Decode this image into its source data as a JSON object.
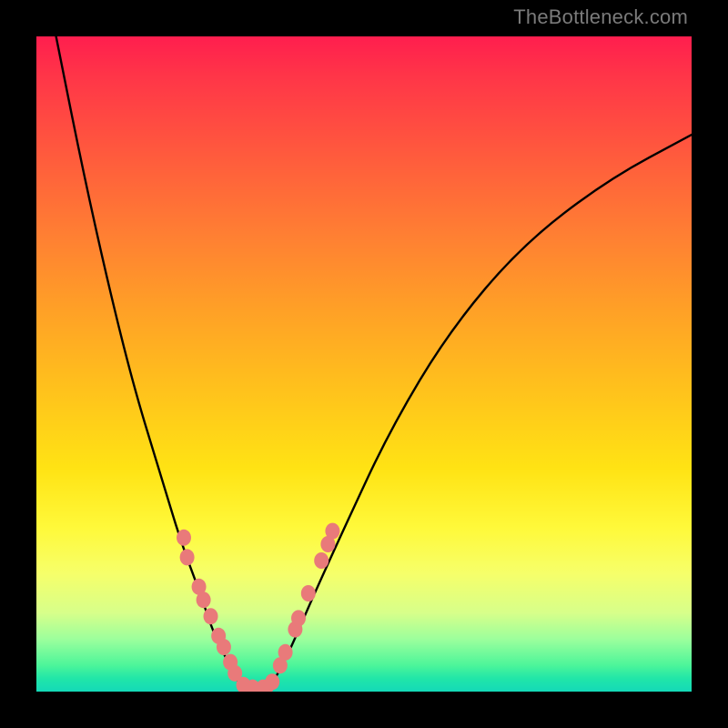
{
  "watermark": "TheBottleneck.com",
  "chart_data": {
    "type": "line",
    "title": "",
    "xlabel": "",
    "ylabel": "",
    "xlim": [
      0,
      1
    ],
    "ylim": [
      0,
      1
    ],
    "annotations": [
      "Background gradient: red (top, worst) → yellow (middle) → green (bottom, best)"
    ],
    "series": [
      {
        "name": "left-curve",
        "x": [
          0.03,
          0.07,
          0.11,
          0.15,
          0.19,
          0.22,
          0.25,
          0.27,
          0.29,
          0.305,
          0.315
        ],
        "values": [
          1.0,
          0.8,
          0.62,
          0.46,
          0.33,
          0.23,
          0.15,
          0.09,
          0.05,
          0.02,
          0.005
        ]
      },
      {
        "name": "right-curve",
        "x": [
          0.355,
          0.37,
          0.39,
          0.42,
          0.47,
          0.54,
          0.63,
          0.74,
          0.87,
          1.0
        ],
        "values": [
          0.005,
          0.03,
          0.07,
          0.14,
          0.25,
          0.4,
          0.55,
          0.68,
          0.78,
          0.85
        ]
      },
      {
        "name": "floor-segment",
        "x": [
          0.315,
          0.355
        ],
        "values": [
          0.005,
          0.005
        ]
      }
    ],
    "markers": {
      "name": "data-points",
      "color": "#e97a7a",
      "points": [
        {
          "x": 0.225,
          "y": 0.235
        },
        {
          "x": 0.23,
          "y": 0.205
        },
        {
          "x": 0.248,
          "y": 0.16
        },
        {
          "x": 0.255,
          "y": 0.14
        },
        {
          "x": 0.266,
          "y": 0.115
        },
        {
          "x": 0.278,
          "y": 0.085
        },
        {
          "x": 0.286,
          "y": 0.068
        },
        {
          "x": 0.296,
          "y": 0.045
        },
        {
          "x": 0.303,
          "y": 0.028
        },
        {
          "x": 0.316,
          "y": 0.01
        },
        {
          "x": 0.33,
          "y": 0.006
        },
        {
          "x": 0.346,
          "y": 0.006
        },
        {
          "x": 0.36,
          "y": 0.015
        },
        {
          "x": 0.372,
          "y": 0.04
        },
        {
          "x": 0.38,
          "y": 0.06
        },
        {
          "x": 0.395,
          "y": 0.095
        },
        {
          "x": 0.4,
          "y": 0.112
        },
        {
          "x": 0.415,
          "y": 0.15
        },
        {
          "x": 0.435,
          "y": 0.2
        },
        {
          "x": 0.445,
          "y": 0.225
        },
        {
          "x": 0.452,
          "y": 0.245
        }
      ]
    }
  }
}
